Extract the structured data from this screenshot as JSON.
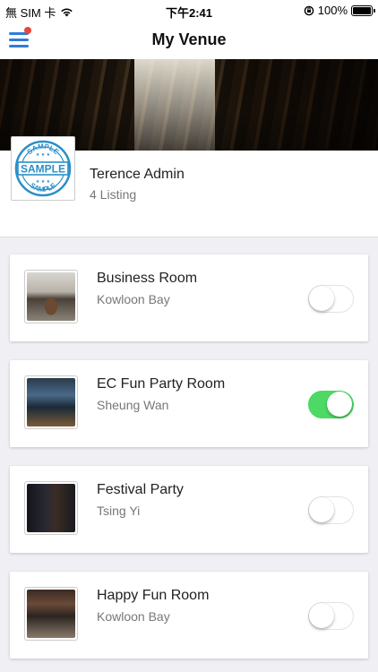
{
  "status_bar": {
    "carrier": "無 SIM 卡",
    "time": "下午2:41",
    "battery": "100%"
  },
  "nav": {
    "title": "My Venue",
    "menu_icon": "hamburger-menu-icon",
    "has_notification": true
  },
  "profile": {
    "name": "Terence Admin",
    "listing_count": "4 Listing",
    "stamp_text": "SAMPLE"
  },
  "listings": [
    {
      "title": "Business Room",
      "location": "Kowloon Bay",
      "enabled": false
    },
    {
      "title": "EC Fun Party Room",
      "location": "Sheung Wan",
      "enabled": true
    },
    {
      "title": "Festival Party",
      "location": "Tsing Yi",
      "enabled": false
    },
    {
      "title": "Happy Fun Room",
      "location": "Kowloon Bay",
      "enabled": false
    }
  ],
  "colors": {
    "accent": "#2f7cd8",
    "toggle_on": "#4cd964",
    "notification_dot": "#e8463a"
  }
}
